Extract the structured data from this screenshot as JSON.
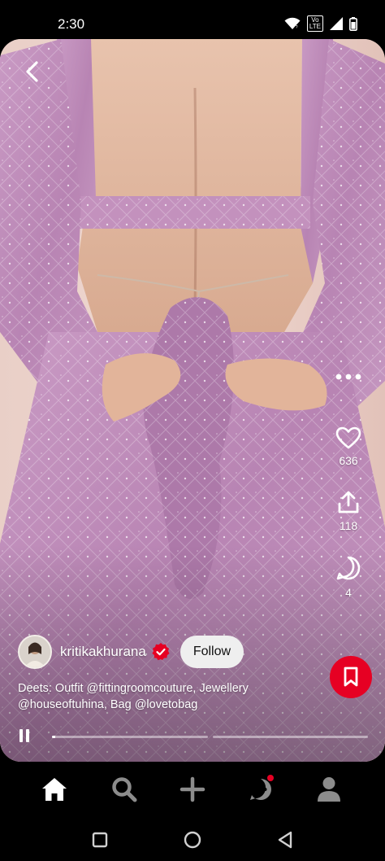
{
  "status_bar": {
    "time": "2:30",
    "network_badge_top": "Vo",
    "network_badge_bottom": "LTE"
  },
  "pin": {
    "author": {
      "name": "kritikakhurana",
      "verified": true
    },
    "follow_label": "Follow",
    "caption_line1": "Deets: Outfit @fittingroomcouture, Jewellery",
    "caption_line2": "@houseoftuhina, Bag @lovetobag",
    "likes": "636",
    "shares": "118",
    "comments": "4",
    "video_progress": 0.02
  },
  "icons": {
    "back": "chevron-left-icon",
    "more": "more-dots-icon",
    "like": "heart-icon",
    "share": "share-icon",
    "comment": "comment-icon",
    "save": "bookmark-icon",
    "pause": "pause-icon",
    "nav": [
      "home-icon",
      "search-icon",
      "plus-icon",
      "messages-icon",
      "profile-icon"
    ]
  },
  "colors": {
    "accent": "#e60023",
    "outfit": "#c99ac4",
    "background": "#000000"
  }
}
